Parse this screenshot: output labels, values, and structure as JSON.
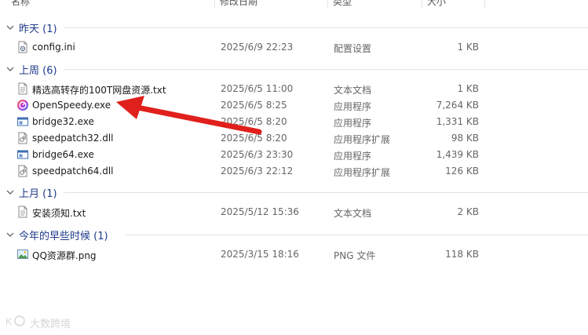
{
  "columns": {
    "name": "名称",
    "date": "修改日期",
    "type": "类型",
    "size": "大小"
  },
  "groups": [
    {
      "title": "昨天 (1)",
      "files": [
        {
          "name": "config.ini",
          "date": "2025/6/9 22:23",
          "type": "配置设置",
          "size": "1 KB",
          "icon": "ini-settings-icon"
        }
      ]
    },
    {
      "title": "上周 (6)",
      "files": [
        {
          "name": "精选高转存的100T网盘资源.txt",
          "date": "2025/6/5 11:00",
          "type": "文本文档",
          "size": "1 KB",
          "icon": "text-file-icon"
        },
        {
          "name": "OpenSpeedy.exe",
          "date": "2025/6/5 8:25",
          "type": "应用程序",
          "size": "7,264 KB",
          "icon": "openspeedy-app-icon"
        },
        {
          "name": "bridge32.exe",
          "date": "2025/6/5 8:20",
          "type": "应用程序",
          "size": "1,331 KB",
          "icon": "exe-window-icon"
        },
        {
          "name": "speedpatch32.dll",
          "date": "2025/6/5 8:20",
          "type": "应用程序扩展",
          "size": "98 KB",
          "icon": "dll-file-icon"
        },
        {
          "name": "bridge64.exe",
          "date": "2025/6/3 23:30",
          "type": "应用程序",
          "size": "1,439 KB",
          "icon": "exe-window-icon"
        },
        {
          "name": "speedpatch64.dll",
          "date": "2025/6/3 22:12",
          "type": "应用程序扩展",
          "size": "126 KB",
          "icon": "dll-file-icon"
        }
      ]
    },
    {
      "title": "上月 (1)",
      "files": [
        {
          "name": "安装须知.txt",
          "date": "2025/5/12 15:36",
          "type": "文本文档",
          "size": "2 KB",
          "icon": "text-file-icon"
        }
      ]
    },
    {
      "title": "今年的早些时候 (1)",
      "files": [
        {
          "name": "QQ资源群.png",
          "date": "2025/3/15 18:16",
          "type": "PNG 文件",
          "size": "118 KB",
          "icon": "image-file-icon"
        }
      ]
    }
  ],
  "annotation": {
    "arrow_color": "#e0201c",
    "target": "OpenSpeedy.exe"
  },
  "watermark": {
    "text": "大数跨境"
  },
  "colors": {
    "group_title": "#1e3a8a",
    "secondary_text": "#666666",
    "divider": "#e3e3e3"
  }
}
